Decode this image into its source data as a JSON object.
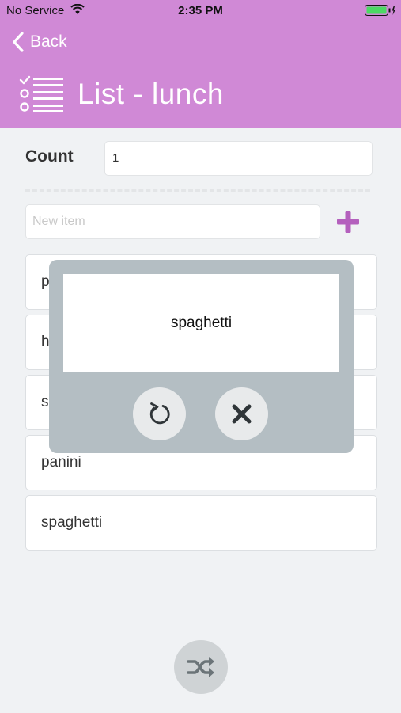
{
  "status_bar": {
    "carrier": "No Service",
    "time": "2:35 PM",
    "battery_color": "#4cd964"
  },
  "nav": {
    "back_label": "Back",
    "title": "List - lunch",
    "header_color": "#d089d6"
  },
  "count": {
    "label": "Count",
    "value": "1"
  },
  "new_item": {
    "placeholder": "New item"
  },
  "items": [
    {
      "label": "p"
    },
    {
      "label": "h"
    },
    {
      "label": "s"
    },
    {
      "label": "panini"
    },
    {
      "label": "spaghetti"
    }
  ],
  "modal": {
    "result": "spaghetti"
  },
  "icons": {
    "back": "chevron-left-icon",
    "list": "checklist-icon",
    "add": "plus-icon",
    "retry": "refresh-icon",
    "close": "close-icon",
    "shuffle": "shuffle-icon"
  }
}
